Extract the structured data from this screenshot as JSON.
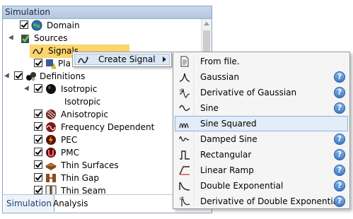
{
  "panel": {
    "title": "Simulation",
    "tabs": [
      {
        "label": "Simulation",
        "active": true
      },
      {
        "label": "Analysis",
        "active": false
      }
    ]
  },
  "tree": {
    "domain": "Domain",
    "sources": "Sources",
    "signals": "Signals",
    "planewave_partial": "Pla",
    "definitions": "Definitions",
    "isotropic_group": "Isotropic",
    "isotropic_item": "Isotropic",
    "anisotropic": "Anisotropic",
    "frequency_dependent": "Frequency Dependent",
    "pec": "PEC",
    "pmc": "PMC",
    "thin_surfaces": "Thin Surfaces",
    "thin_gap": "Thin Gap",
    "thin_seam": "Thin Seam"
  },
  "context_menu": {
    "create_signal": "Create Signal"
  },
  "submenu": {
    "items": [
      {
        "label": "From file.",
        "icon": "file-icon",
        "help": false
      },
      {
        "label": "Gaussian",
        "icon": "gaussian-icon",
        "help": true
      },
      {
        "label": "Derivative of Gaussian",
        "icon": "derivative-gaussian-icon",
        "help": true
      },
      {
        "label": "Sine",
        "icon": "sine-icon",
        "help": true
      },
      {
        "label": "Sine Squared",
        "icon": "sine-squared-icon",
        "help": true,
        "highlighted": true
      },
      {
        "label": "Damped Sine",
        "icon": "damped-sine-icon",
        "help": true
      },
      {
        "label": "Rectangular",
        "icon": "rectangular-icon",
        "help": true
      },
      {
        "label": "Linear Ramp",
        "icon": "linear-ramp-icon",
        "help": true
      },
      {
        "label": "Double Exponential",
        "icon": "double-exponential-icon",
        "help": true
      },
      {
        "label": "Derivative of Double Exponential",
        "icon": "derivative-double-exponential-icon",
        "help": true
      }
    ],
    "help_glyph": "?"
  },
  "colors": {
    "selection": "#fbd56d",
    "menu_highlight": "#e3edf8",
    "help_blue": "#3d78c4"
  }
}
